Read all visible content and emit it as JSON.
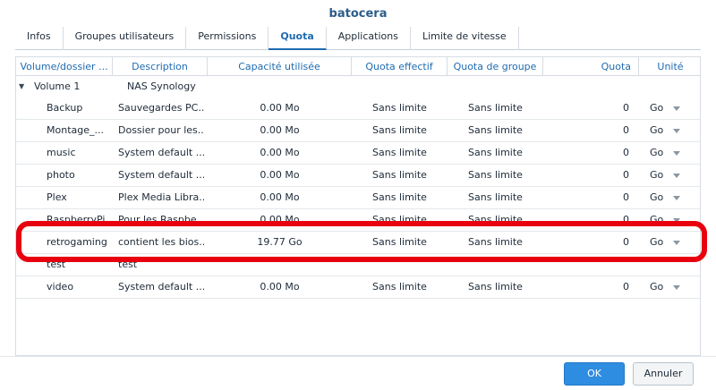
{
  "window": {
    "title": "batocera"
  },
  "tabs": [
    {
      "label": "Infos"
    },
    {
      "label": "Groupes utilisateurs"
    },
    {
      "label": "Permissions"
    },
    {
      "label": "Quota"
    },
    {
      "label": "Applications"
    },
    {
      "label": "Limite de vitesse"
    }
  ],
  "active_tab": "Quota",
  "table": {
    "headers": {
      "volume": "Volume/dossier ...",
      "description": "Description",
      "capacity": "Capacité utilisée",
      "effective": "Quota effectif",
      "group": "Quota de groupe",
      "quota": "Quota",
      "unit": "Unité"
    },
    "group_row": {
      "name": "Volume 1",
      "description": "NAS Synology"
    },
    "rows": [
      {
        "name": "Backup",
        "description": "Sauvegardes PC...",
        "capacity": "0.00 Mo",
        "effective": "Sans limite",
        "group": "Sans limite",
        "quota": "0",
        "unit": "Go"
      },
      {
        "name": "Montage_...",
        "description": "Dossier pour les...",
        "capacity": "0.00 Mo",
        "effective": "Sans limite",
        "group": "Sans limite",
        "quota": "0",
        "unit": "Go"
      },
      {
        "name": "music",
        "description": "System default ...",
        "capacity": "0.00 Mo",
        "effective": "Sans limite",
        "group": "Sans limite",
        "quota": "0",
        "unit": "Go"
      },
      {
        "name": "photo",
        "description": "System default ...",
        "capacity": "0.00 Mo",
        "effective": "Sans limite",
        "group": "Sans limite",
        "quota": "0",
        "unit": "Go"
      },
      {
        "name": "Plex",
        "description": "Plex Media Libra...",
        "capacity": "0.00 Mo",
        "effective": "Sans limite",
        "group": "Sans limite",
        "quota": "0",
        "unit": "Go"
      },
      {
        "name": "RaspberryPi",
        "description": "Pour les Raspbe...",
        "capacity": "0.00 Mo",
        "effective": "Sans limite",
        "group": "Sans limite",
        "quota": "0",
        "unit": "Go"
      },
      {
        "name": "retrogaming",
        "description": "contient les bios...",
        "capacity": "19.77 Go",
        "effective": "Sans limite",
        "group": "Sans limite",
        "quota": "0",
        "unit": "Go"
      },
      {
        "name": "test",
        "description": "test",
        "capacity": "",
        "effective": "",
        "group": "",
        "quota": "",
        "unit": ""
      },
      {
        "name": "video",
        "description": "System default ...",
        "capacity": "0.00 Mo",
        "effective": "Sans limite",
        "group": "Sans limite",
        "quota": "0",
        "unit": "Go"
      }
    ]
  },
  "buttons": {
    "ok": "OK",
    "cancel": "Annuler"
  },
  "colors": {
    "accent": "#1f6bb0",
    "highlight": "#e8000f",
    "ok_button": "#2f8de1"
  }
}
